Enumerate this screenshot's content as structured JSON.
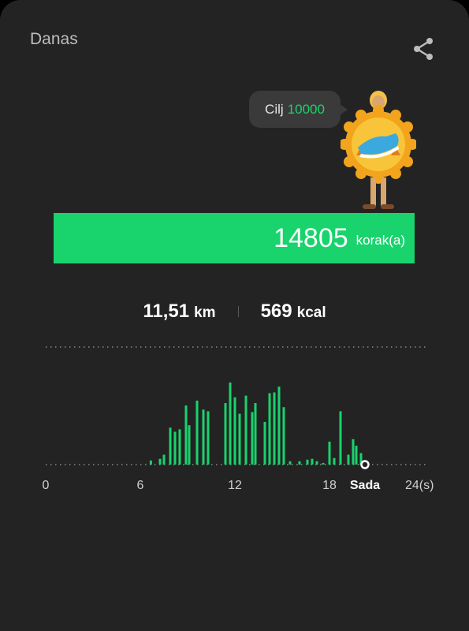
{
  "header": {
    "title": "Danas",
    "share_icon": "share-icon"
  },
  "goal": {
    "label": "Cilj",
    "value": "10000"
  },
  "steps": {
    "value": "14805",
    "unit": "korak(a)",
    "goal_progress": 1.0
  },
  "stats": {
    "distance_value": "11,51",
    "distance_unit": "km",
    "calories_value": "569",
    "calories_unit": "kcal"
  },
  "colors": {
    "accent": "#19d36d",
    "background": "#232323",
    "bubble": "#3a3a3a"
  },
  "chart_data": {
    "type": "bar",
    "x_tick_labels": [
      "0",
      "6",
      "12",
      "18",
      "24(s)"
    ],
    "x_ticks": [
      0,
      6,
      12,
      18,
      24
    ],
    "now_label": "Sada",
    "now_x": 20.25,
    "xlim": [
      0,
      24
    ],
    "ylim": [
      0,
      100
    ],
    "bars": [
      {
        "x": 6.67,
        "y": 5
      },
      {
        "x": 7.25,
        "y": 7
      },
      {
        "x": 7.5,
        "y": 12
      },
      {
        "x": 7.9,
        "y": 45
      },
      {
        "x": 8.2,
        "y": 40
      },
      {
        "x": 8.5,
        "y": 43
      },
      {
        "x": 8.9,
        "y": 72
      },
      {
        "x": 9.1,
        "y": 48
      },
      {
        "x": 9.6,
        "y": 78
      },
      {
        "x": 10.0,
        "y": 67
      },
      {
        "x": 10.3,
        "y": 65
      },
      {
        "x": 11.4,
        "y": 75
      },
      {
        "x": 11.7,
        "y": 100
      },
      {
        "x": 12.0,
        "y": 82
      },
      {
        "x": 12.3,
        "y": 62
      },
      {
        "x": 12.7,
        "y": 84
      },
      {
        "x": 13.1,
        "y": 64
      },
      {
        "x": 13.3,
        "y": 75
      },
      {
        "x": 13.9,
        "y": 52
      },
      {
        "x": 14.2,
        "y": 87
      },
      {
        "x": 14.5,
        "y": 88
      },
      {
        "x": 14.8,
        "y": 95
      },
      {
        "x": 15.1,
        "y": 70
      },
      {
        "x": 15.5,
        "y": 4
      },
      {
        "x": 16.1,
        "y": 4
      },
      {
        "x": 16.6,
        "y": 6
      },
      {
        "x": 16.9,
        "y": 7
      },
      {
        "x": 17.2,
        "y": 4
      },
      {
        "x": 17.6,
        "y": 2
      },
      {
        "x": 18.0,
        "y": 28
      },
      {
        "x": 18.3,
        "y": 8
      },
      {
        "x": 18.7,
        "y": 65
      },
      {
        "x": 19.2,
        "y": 12
      },
      {
        "x": 19.5,
        "y": 31
      },
      {
        "x": 19.7,
        "y": 23
      },
      {
        "x": 20.0,
        "y": 14
      }
    ]
  }
}
